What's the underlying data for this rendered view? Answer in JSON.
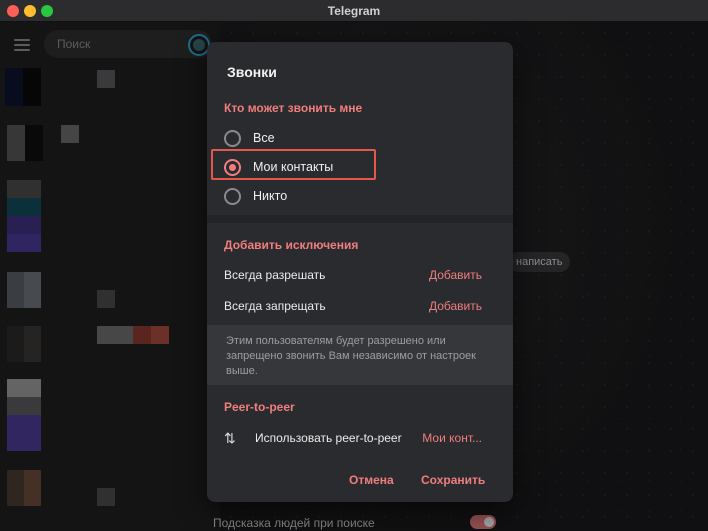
{
  "window": {
    "title": "Telegram"
  },
  "sidebar": {
    "search_placeholder": "Поиск"
  },
  "background": {
    "write_button": "написать",
    "people_hint_label": "Подсказка людей при поиске"
  },
  "dialog": {
    "title": "Звонки",
    "who_can_call": {
      "heading": "Кто может звонить мне",
      "options": [
        "Все",
        "Мои контакты",
        "Никто"
      ],
      "selected": "Мои контакты"
    },
    "exceptions": {
      "heading": "Добавить исключения",
      "rows": [
        {
          "label": "Всегда разрешать",
          "action": "Добавить"
        },
        {
          "label": "Всегда запрещать",
          "action": "Добавить"
        }
      ],
      "note": "Этим пользователям будет разрешено или запрещено звонить Вам независимо от настроек выше."
    },
    "p2p": {
      "heading": "Peer-to-peer",
      "label": "Использовать peer-to-peer",
      "value": "Мои конт..."
    },
    "buttons": {
      "cancel": "Отмена",
      "save": "Сохранить"
    }
  },
  "colors": {
    "accent": "#f07e7e",
    "highlight": "#e4584b",
    "dialog_bg": "#2a2b2e"
  }
}
